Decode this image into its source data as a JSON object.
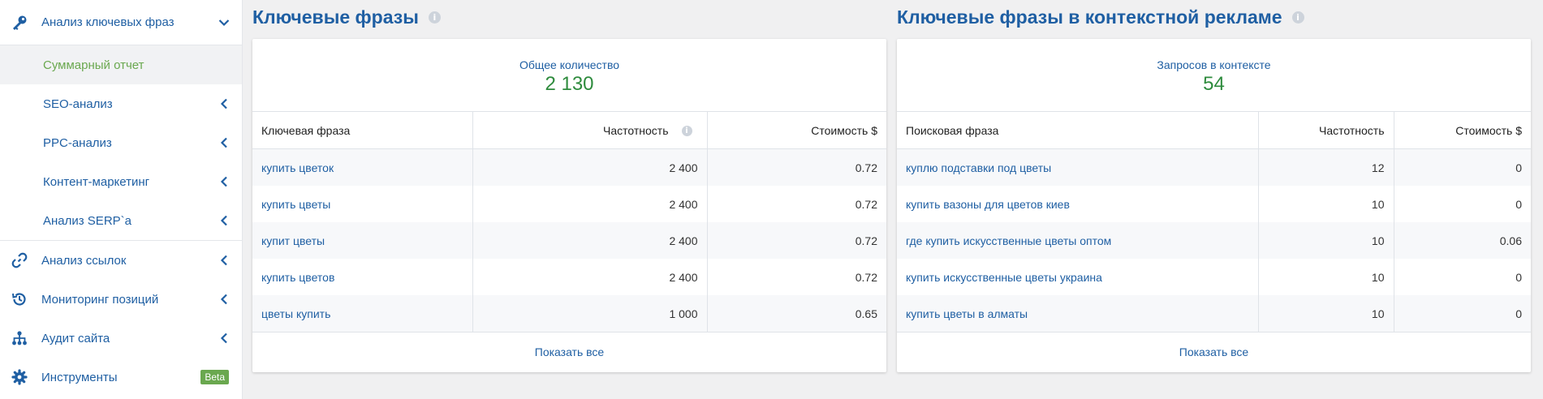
{
  "sidebar": {
    "section": {
      "label": "Анализ ключевых фраз"
    },
    "subitems": [
      {
        "label": "Суммарный отчет"
      },
      {
        "label": "SEO-анализ"
      },
      {
        "label": "PPC-анализ"
      },
      {
        "label": "Контент-маркетинг"
      },
      {
        "label": "Анализ SERP`a"
      }
    ],
    "items": [
      {
        "label": "Анализ ссылок"
      },
      {
        "label": "Мониторинг позиций"
      },
      {
        "label": "Аудит сайта"
      },
      {
        "label": "Инструменты",
        "badge": "Beta"
      }
    ]
  },
  "keywords_panel": {
    "title": "Ключевые фразы",
    "summary_label": "Общее количество",
    "summary_value": "2 130",
    "columns": [
      "Ключевая фраза",
      "Частотность",
      "Стоимость $"
    ],
    "rows": [
      [
        "купить цветок",
        "2 400",
        "0.72"
      ],
      [
        "купить цветы",
        "2 400",
        "0.72"
      ],
      [
        "купит цветы",
        "2 400",
        "0.72"
      ],
      [
        "купить цветов",
        "2 400",
        "0.72"
      ],
      [
        "цветы купить",
        "1 000",
        "0.65"
      ]
    ],
    "show_all": "Показать все"
  },
  "ads_panel": {
    "title": "Ключевые фразы в контекстной рекламе",
    "summary_label": "Запросов в контексте",
    "summary_value": "54",
    "columns": [
      "Поисковая фраза",
      "Частотность",
      "Стоимость $"
    ],
    "rows": [
      [
        "куплю подставки под цветы",
        "12",
        "0"
      ],
      [
        "купить вазоны для цветов киев",
        "10",
        "0"
      ],
      [
        "где купить искусственные цветы оптом",
        "10",
        "0.06"
      ],
      [
        "купить искусственные цветы украина",
        "10",
        "0"
      ],
      [
        "купить цветы в алматы",
        "10",
        "0"
      ]
    ],
    "show_all": "Показать все"
  },
  "colors": {
    "link": "#1f5fa3",
    "green": "#2e8b3d",
    "active_sub": "#6aa84f"
  },
  "icons": [
    "key-icon",
    "chevron-down-icon",
    "chevron-left-icon",
    "link-icon",
    "history-icon",
    "sitemap-icon",
    "gear-icon",
    "info-icon"
  ]
}
